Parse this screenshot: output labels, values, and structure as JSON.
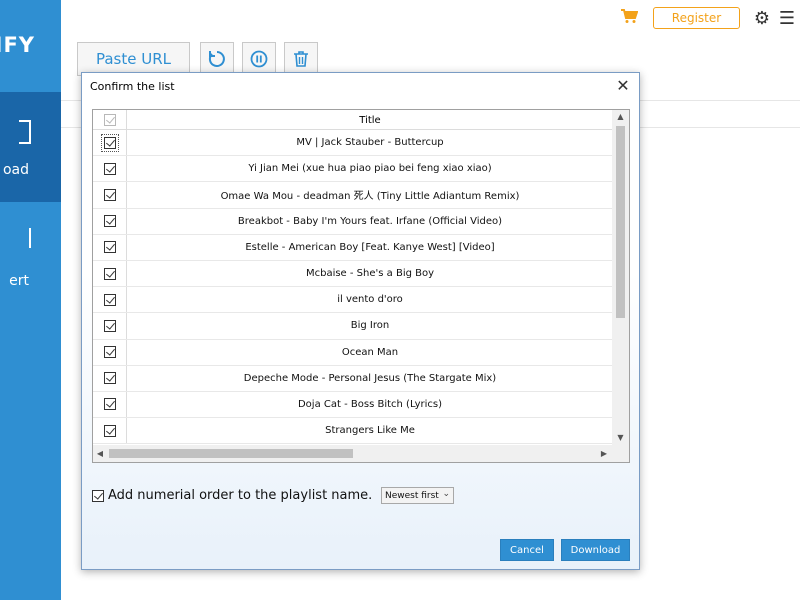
{
  "app": {
    "logo_text": "IFY"
  },
  "sidebar": {
    "items": [
      {
        "label": "oad",
        "icon": "download-icon"
      },
      {
        "label": "ert",
        "icon": "convert-icon"
      }
    ]
  },
  "topbar": {
    "register_label": "Register",
    "icons": [
      "cart-icon",
      "gear-icon",
      "menu-icon"
    ]
  },
  "toolbar": {
    "paste_label": "Paste URL",
    "icons": [
      "refresh-icon",
      "pause-icon",
      "trash-icon"
    ]
  },
  "dialog": {
    "title": "Confirm the list",
    "column_title": "Title",
    "rows": [
      {
        "title": "MV | Jack Stauber - Buttercup",
        "checked": true
      },
      {
        "title": "Yi Jian Mei (xue hua piao piao bei feng xiao xiao)",
        "checked": true
      },
      {
        "title": "Omae Wa Mou - deadman 死人 (Tiny Little Adiantum Remix)",
        "checked": true
      },
      {
        "title": "Breakbot - Baby I'm Yours feat. Irfane (Official Video)",
        "checked": true
      },
      {
        "title": "Estelle - American Boy [Feat. Kanye West] [Video]",
        "checked": true
      },
      {
        "title": "Mcbaise - She's a Big Boy",
        "checked": true
      },
      {
        "title": "il vento d'oro",
        "checked": true
      },
      {
        "title": "Big Iron",
        "checked": true
      },
      {
        "title": "Ocean Man",
        "checked": true
      },
      {
        "title": "Depeche Mode - Personal Jesus (The Stargate Mix)",
        "checked": true
      },
      {
        "title": "Doja Cat - Boss Bitch (Lyrics)",
        "checked": true
      },
      {
        "title": "Strangers Like Me",
        "checked": true
      }
    ],
    "order_label": "Add numerial order to the playlist name.",
    "order_checked": true,
    "order_select_value": "Newest first",
    "cancel_label": "Cancel",
    "download_label": "Download"
  },
  "colors": {
    "accent": "#2f8fd2",
    "sidebar_active": "#1a66a8",
    "register": "#f3a21a"
  }
}
